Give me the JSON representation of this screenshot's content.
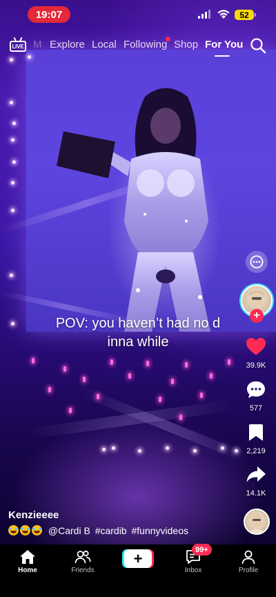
{
  "status_bar": {
    "time": "19:07",
    "battery": "52"
  },
  "top_nav": {
    "tabs": [
      {
        "label": "M"
      },
      {
        "label": "Explore"
      },
      {
        "label": "Local"
      },
      {
        "label": "Following"
      },
      {
        "label": "Shop"
      },
      {
        "label": "For You"
      }
    ],
    "live_label": "LIVE",
    "active_tab": "For You"
  },
  "video": {
    "caption_lines": [
      "POV: you haven’t had no d",
      "inna while"
    ]
  },
  "rail": {
    "likes": "39.9K",
    "comments": "577",
    "saves": "2,219",
    "shares": "14.1K",
    "like_color": "#fe2c55"
  },
  "post": {
    "username": "Kenzieeee",
    "mention": "@Cardi B",
    "hashtags": [
      "#cardib",
      "#funnyvideos"
    ]
  },
  "tab_bar": {
    "items": [
      {
        "label": "Home",
        "icon": "home-icon"
      },
      {
        "label": "Friends",
        "icon": "friends-icon"
      },
      {
        "label": "Inbox",
        "icon": "inbox-icon"
      },
      {
        "label": "Profile",
        "icon": "profile-icon"
      }
    ],
    "create_label": "+",
    "inbox_badge": "99+"
  },
  "colors": {
    "accent": "#fe2c55",
    "cyan": "#25f4ee",
    "time_pill": "#e5283a",
    "battery": "#f5d90a"
  }
}
